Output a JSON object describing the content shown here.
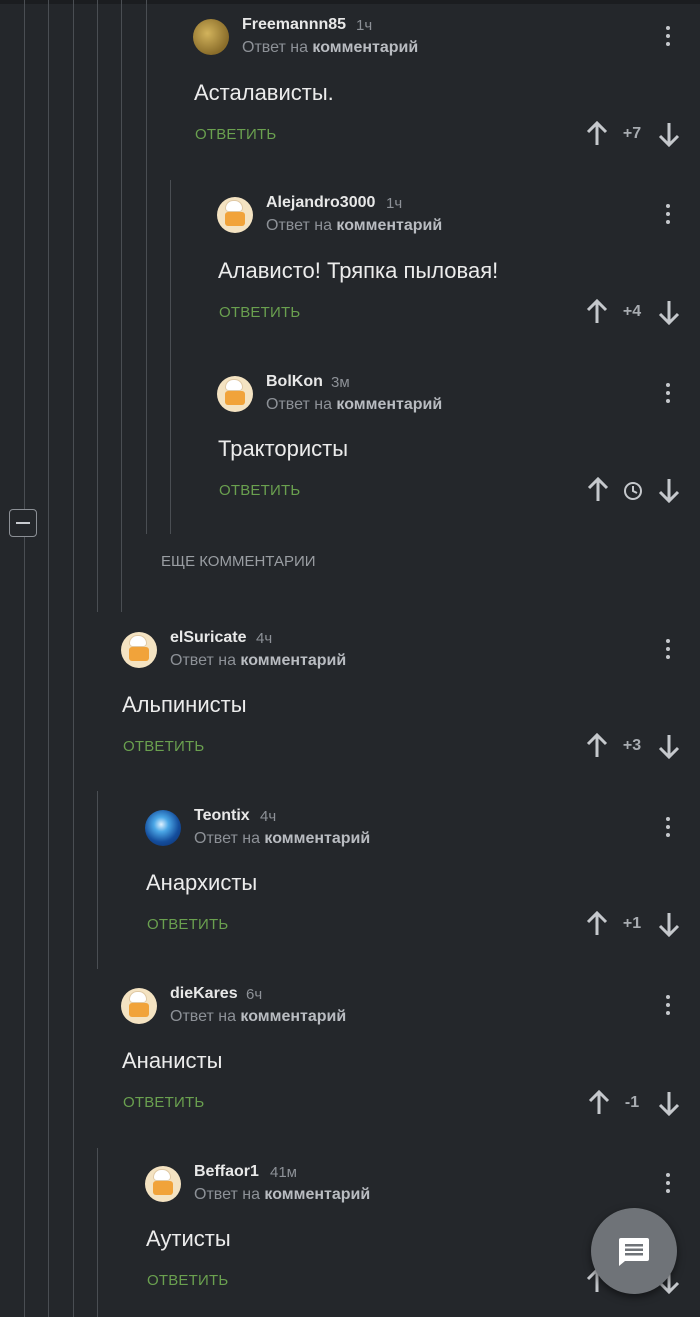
{
  "comments": [
    {
      "user": "Freemannn85",
      "time": "1ч",
      "reply_prefix": "Ответ на",
      "reply_target": "комментарий",
      "text": "Асталависты.",
      "reply": "ОТВЕТИТЬ",
      "score": "+7",
      "avatar": "coin-avatar"
    },
    {
      "user": "Alejandro3000",
      "time": "1ч",
      "reply_prefix": "Ответ на",
      "reply_target": "комментарий",
      "text": "Алависто! Тряпка пыловая!",
      "reply": "ОТВЕТИТЬ",
      "score": "+4",
      "avatar": "chef-avatar"
    },
    {
      "user": "BolKon",
      "time": "3м",
      "reply_prefix": "Ответ на",
      "reply_target": "комментарий",
      "text": "Трактористы",
      "reply": "ОТВЕТИТЬ",
      "score": "",
      "avatar": "chef-avatar"
    },
    {
      "user": "elSuricate",
      "time": "4ч",
      "reply_prefix": "Ответ на",
      "reply_target": "комментарий",
      "text": "Альпинисты",
      "reply": "ОТВЕТИТЬ",
      "score": "+3",
      "avatar": "chef-avatar"
    },
    {
      "user": "Teontix",
      "time": "4ч",
      "reply_prefix": "Ответ на",
      "reply_target": "комментарий",
      "text": "Анархисты",
      "reply": "ОТВЕТИТЬ",
      "score": "+1",
      "avatar": "globe-avatar"
    },
    {
      "user": "dieKares",
      "time": "6ч",
      "reply_prefix": "Ответ на",
      "reply_target": "комментарий",
      "text": "Ананисты",
      "reply": "ОТВЕТИТЬ",
      "score": "-1",
      "avatar": "chef-avatar"
    },
    {
      "user": "Beffaor1",
      "time": "41м",
      "reply_prefix": "Ответ на",
      "reply_target": "комментарий",
      "text": "Аутисты",
      "reply": "ОТВЕТИТЬ",
      "score": "",
      "avatar": "chef-avatar"
    }
  ],
  "more_comments": "ЕЩЕ КОММЕНТАРИИ",
  "icons": {
    "collapse": "collapse-thread-icon",
    "upvote": "arrow-up-icon",
    "downvote": "arrow-down-icon",
    "menu": "more-vertical-icon",
    "pending": "clock-icon",
    "fab": "comment-icon"
  },
  "colors": {
    "background": "#24272b",
    "reply_green": "#6aa04f",
    "muted": "#8d9197"
  }
}
